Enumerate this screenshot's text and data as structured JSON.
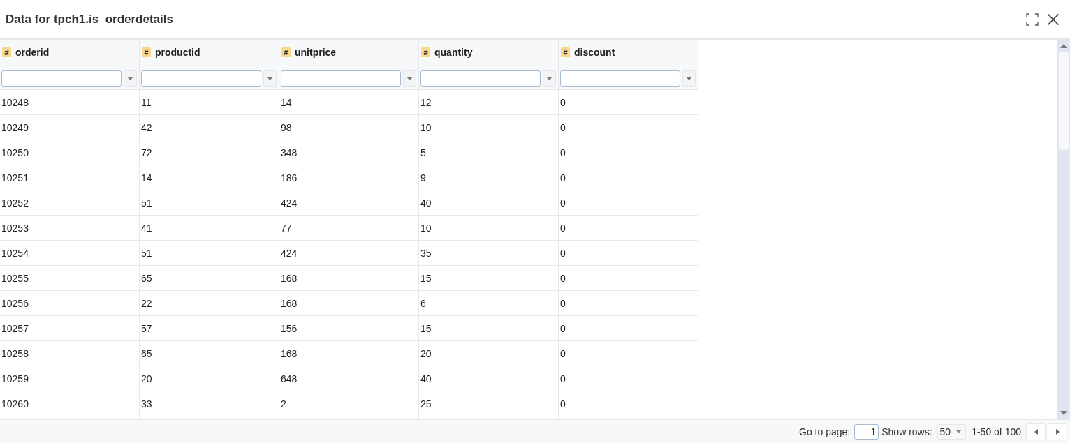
{
  "window": {
    "title": "Data for tpch1.is_orderdetails"
  },
  "table": {
    "columns": [
      {
        "type_glyph": "#",
        "name": "orderid"
      },
      {
        "type_glyph": "#",
        "name": "productid"
      },
      {
        "type_glyph": "#",
        "name": "unitprice"
      },
      {
        "type_glyph": "#",
        "name": "quantity"
      },
      {
        "type_glyph": "#",
        "name": "discount"
      }
    ],
    "rows": [
      [
        "10248",
        "11",
        "14",
        "12",
        "0"
      ],
      [
        "10249",
        "42",
        "98",
        "10",
        "0"
      ],
      [
        "10250",
        "72",
        "348",
        "5",
        "0"
      ],
      [
        "10251",
        "14",
        "186",
        "9",
        "0"
      ],
      [
        "10252",
        "51",
        "424",
        "40",
        "0"
      ],
      [
        "10253",
        "41",
        "77",
        "10",
        "0"
      ],
      [
        "10254",
        "51",
        "424",
        "35",
        "0"
      ],
      [
        "10255",
        "65",
        "168",
        "15",
        "0"
      ],
      [
        "10256",
        "22",
        "168",
        "6",
        "0"
      ],
      [
        "10257",
        "57",
        "156",
        "15",
        "0"
      ],
      [
        "10258",
        "65",
        "168",
        "20",
        "0"
      ],
      [
        "10259",
        "20",
        "648",
        "40",
        "0"
      ],
      [
        "10260",
        "33",
        "2",
        "25",
        "0"
      ]
    ]
  },
  "pagination": {
    "go_to_page_label": "Go to page:",
    "page_value": "1",
    "show_rows_label": "Show rows:",
    "rows_per_page": "50",
    "range": "1-50 of 100"
  }
}
